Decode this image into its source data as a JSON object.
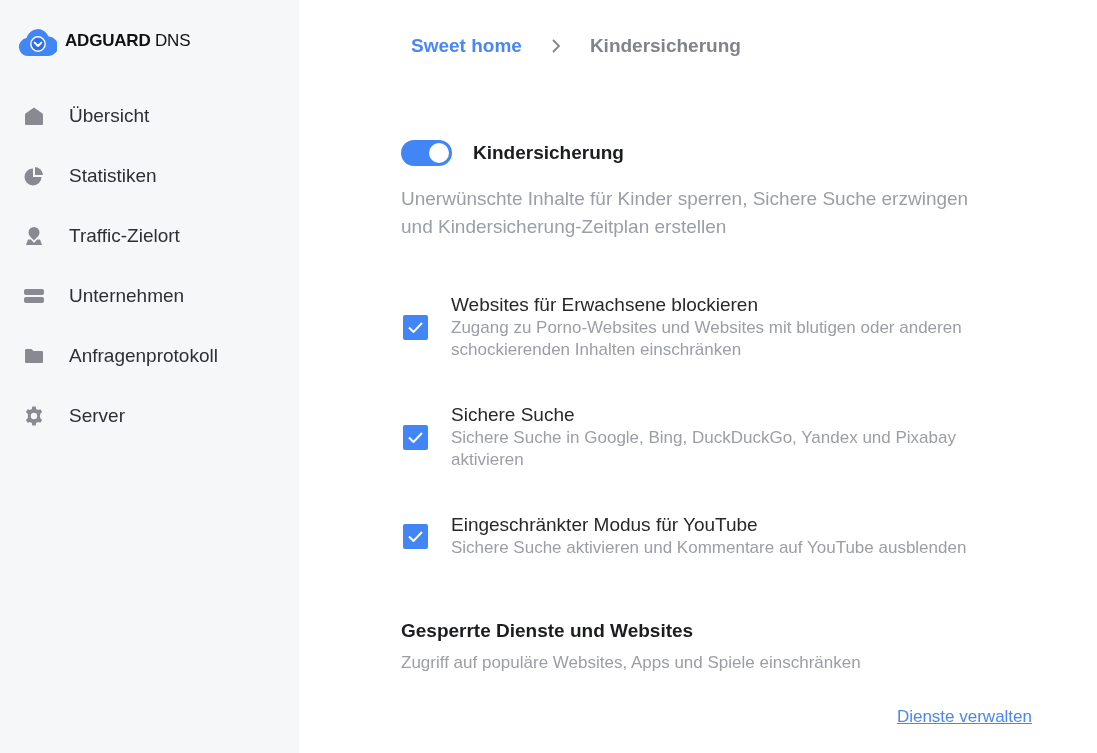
{
  "sidebar": {
    "logo": "**ADGUARD** DNS",
    "items": [
      {
        "label": "Übersicht",
        "kind": "home"
      },
      {
        "label": "Statistiken",
        "kind": "pie"
      },
      {
        "label": "Traffic-Zielort",
        "kind": "location"
      },
      {
        "label": "Unternehmen",
        "kind": "stack"
      },
      {
        "label": "Anfragenprotokoll",
        "kind": "folder"
      },
      {
        "label": "Server",
        "kind": "gear"
      }
    ]
  },
  "breadcrumb": [
    {
      "label": "Sweet home",
      "kind": "link"
    },
    {
      "label": "Kindersicherung",
      "kind": "current"
    }
  ],
  "parental_control": {
    "toggle": {
      "label": "Kindersicherung",
      "on": true
    },
    "description": "Unerwünschte Inhalte für Kinder sperren, Sichere Suche erzwingen und Kindersicherung-Zeitplan erstellen",
    "options": [
      {
        "title": "Websites für Erwachsene blockieren",
        "description": "Zugang zu Porno-Websites und Websites mit blutigen oder anderen schockierenden Inhalten einschränken",
        "checked": true
      },
      {
        "title": "Sichere Suche",
        "description": "Sichere Suche in Google, Bing, DuckDuckGo, Yandex und Pixabay aktivieren",
        "checked": true
      },
      {
        "title": "Eingeschränkter Modus für YouTube",
        "description": "Sichere Suche aktivieren und Kommentare auf YouTube ausblenden",
        "checked": true
      }
    ]
  },
  "blocked_services": {
    "title": "Gesperrte Dienste und Websites",
    "description": "Zugriff auf populäre Websites, Apps und Spiele einschränken",
    "link": "Dienste verwalten"
  }
}
